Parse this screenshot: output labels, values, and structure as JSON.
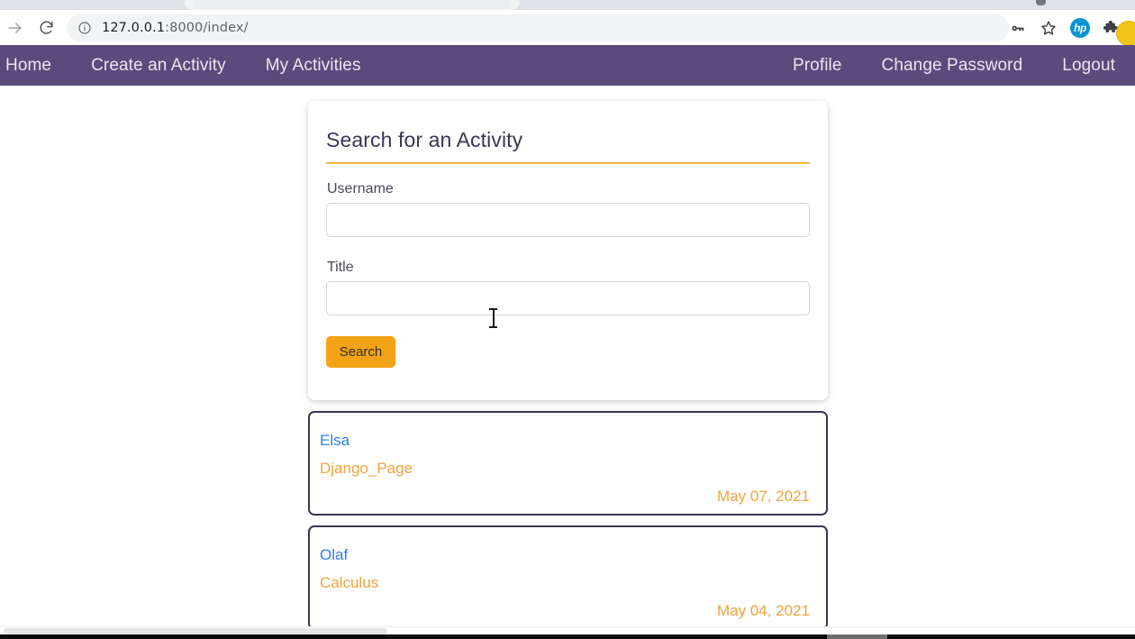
{
  "browser": {
    "url_host": "127.0.0.1",
    "url_path": ":8000/index/",
    "icons": {
      "back": "back-arrow-icon",
      "forward": "forward-arrow-icon",
      "reload": "reload-icon",
      "site_info": "info-circle-icon",
      "password": "key-icon",
      "bookmark": "star-icon",
      "hp_extension": "hp",
      "extensions": "puzzle-piece-icon",
      "profile": "profile-avatar-icon"
    }
  },
  "navbar": {
    "left_links": [
      {
        "label": "Home"
      },
      {
        "label": "Create an Activity"
      },
      {
        "label": "My Activities"
      }
    ],
    "right_links": [
      {
        "label": "Profile"
      },
      {
        "label": "Change Password"
      },
      {
        "label": "Logout"
      }
    ],
    "background": "#5b4b7d"
  },
  "search_card": {
    "title": "Search for an Activity",
    "accent_color": "#f0b73e",
    "fields": [
      {
        "label": "Username",
        "value": "",
        "placeholder": ""
      },
      {
        "label": "Title",
        "value": "",
        "placeholder": ""
      }
    ],
    "submit_label": "Search",
    "submit_color": "#f5a316"
  },
  "results": [
    {
      "username": "Elsa",
      "title": "Django_Page",
      "date": "May 07, 2021"
    },
    {
      "username": "Olaf",
      "title": "Calculus",
      "date": "May 04, 2021"
    }
  ]
}
